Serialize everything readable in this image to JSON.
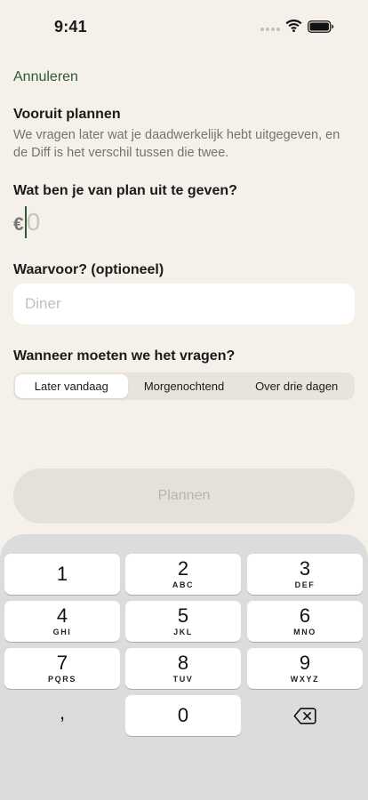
{
  "status": {
    "time": "9:41"
  },
  "cancel_label": "Annuleren",
  "plan": {
    "title": "Vooruit plannen",
    "description": "We vragen later wat je daadwerkelijk hebt uitgegeven, en de Diff is het verschil tussen die twee."
  },
  "amount": {
    "question": "Wat ben je van plan uit te geven?",
    "currency": "€",
    "placeholder": "0"
  },
  "purpose": {
    "label": "Waarvoor? (optioneel)",
    "placeholder": "Diner"
  },
  "when": {
    "label": "Wanneer moeten we het vragen?",
    "options": [
      "Later vandaag",
      "Morgenochtend",
      "Over drie dagen"
    ],
    "selected": "Later vandaag"
  },
  "submit_label": "Plannen",
  "keypad": {
    "keys": [
      {
        "num": "1",
        "letters": ""
      },
      {
        "num": "2",
        "letters": "ABC"
      },
      {
        "num": "3",
        "letters": "DEF"
      },
      {
        "num": "4",
        "letters": "GHI"
      },
      {
        "num": "5",
        "letters": "JKL"
      },
      {
        "num": "6",
        "letters": "MNO"
      },
      {
        "num": "7",
        "letters": "PQRS"
      },
      {
        "num": "8",
        "letters": "TUV"
      },
      {
        "num": "9",
        "letters": "WXYZ"
      }
    ],
    "decimal": ",",
    "zero": "0",
    "backspace_icon": "delete-left-icon"
  },
  "colors": {
    "accent": "#2e5a2f",
    "background": "#f5f1ea",
    "keyboard": "#dcdcdc"
  }
}
